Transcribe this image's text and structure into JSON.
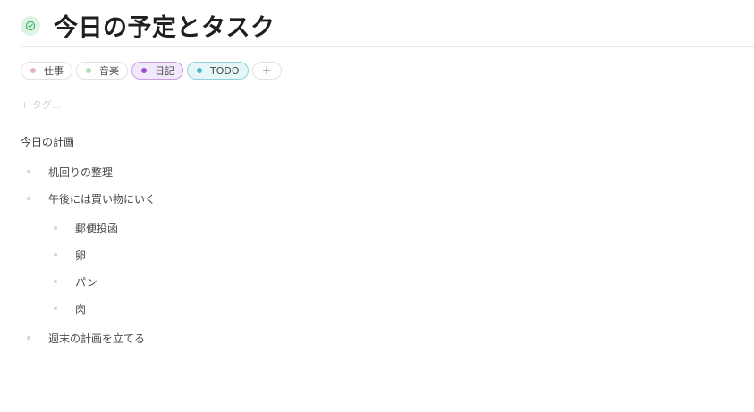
{
  "page": {
    "title": "今日の予定とタスク",
    "title_icon": "check-circle-icon",
    "accent_color": "#3ab561"
  },
  "tags": [
    {
      "label": "仕事",
      "color": "#e8b4b8",
      "active": false
    },
    {
      "label": "音楽",
      "color": "#a8e0b8",
      "active": false
    },
    {
      "label": "日記",
      "color": "#9b4fd6",
      "active": true
    },
    {
      "label": "TODO",
      "color": "#3db9c9",
      "active": true
    }
  ],
  "tag_add_label": "+",
  "tag_input_placeholder": "+ タグ...",
  "content": {
    "heading": "今日の計画",
    "items": [
      {
        "text": "机回りの整理",
        "level": 0
      },
      {
        "text": "午後には買い物にいく",
        "level": 0
      },
      {
        "text": "郵便投函",
        "level": 1
      },
      {
        "text": "卵",
        "level": 1
      },
      {
        "text": "パン",
        "level": 1
      },
      {
        "text": "肉",
        "level": 1
      },
      {
        "text": "週末の計画を立てる",
        "level": 0
      }
    ]
  }
}
